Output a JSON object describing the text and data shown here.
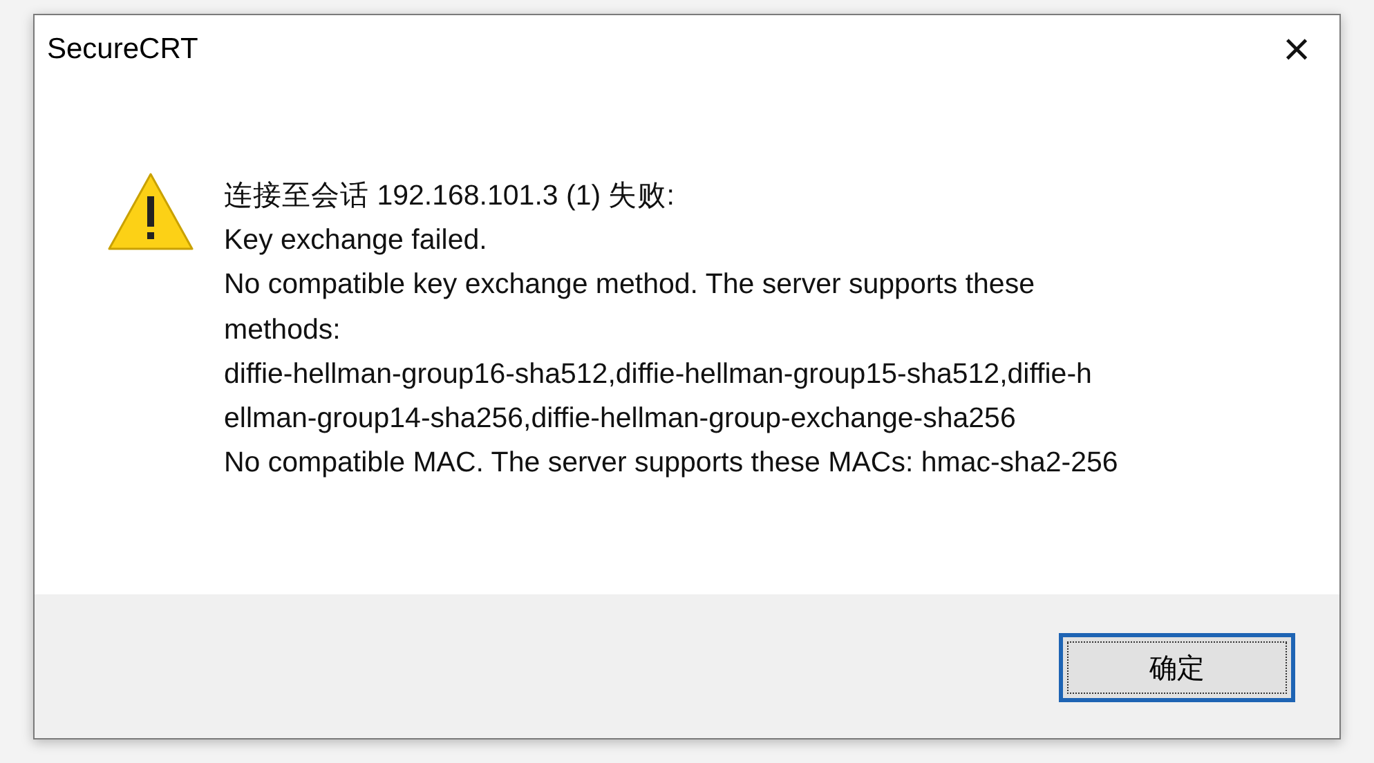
{
  "window": {
    "title": "SecureCRT",
    "close": "×"
  },
  "message": {
    "lines": [
      "连接至会话 192.168.101.3 (1) 失败:",
      "Key exchange failed.",
      "No compatible key exchange method. The server supports these",
      "methods:",
      "diffie-hellman-group16-sha512,diffie-hellman-group15-sha512,diffie-h",
      "ellman-group14-sha256,diffie-hellman-group-exchange-sha256",
      "No compatible MAC. The server supports these MACs: hmac-sha2-256"
    ]
  },
  "buttons": [
    {
      "label": "确定",
      "focused": true
    }
  ]
}
